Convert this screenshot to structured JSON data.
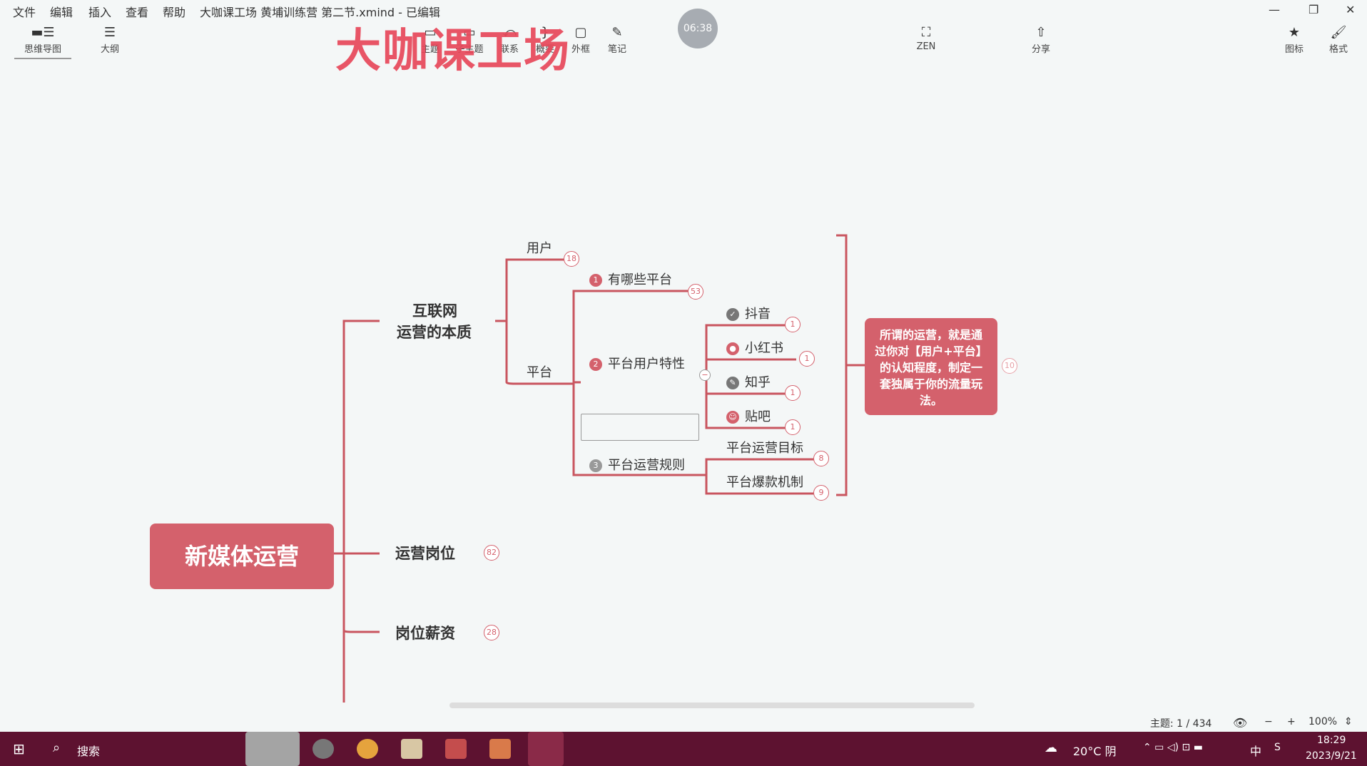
{
  "menu": {
    "file": "文件",
    "edit": "编辑",
    "insert": "插入",
    "view": "查看",
    "help": "帮助",
    "title": "大咖课工场 黄埔训练营 第二节.xmind - 已编辑"
  },
  "toolbar": {
    "mindmap": "思维导图",
    "outline": "大纲",
    "topic": "主题",
    "subtopic": "子主题",
    "relation": "联系",
    "summary": "概要",
    "boundary": "外框",
    "note": "笔记",
    "zen": "ZEN",
    "share": "分享",
    "icon": "图标",
    "format": "格式"
  },
  "watermark": "大咖课工场",
  "timer": "06:38",
  "map": {
    "root": "新媒体运营",
    "branch1": "互联网",
    "branch1b": "运营的本质",
    "branch2": "运营岗位",
    "branch2_count": "82",
    "branch3": "岗位薪资",
    "branch3_count": "28",
    "user": "用户",
    "user_count": "18",
    "platform": "平台",
    "which": "有哪些平台",
    "which_num": "1",
    "which_count": "53",
    "traits": "平台用户特性",
    "traits_num": "2",
    "rules": "平台运营规则",
    "rules_num": "3",
    "douyin": "抖音",
    "xhs": "小红书",
    "zhihu": "知乎",
    "tieba": "贴吧",
    "leaf_count": "1",
    "goal": "平台运营目标",
    "goal_count": "8",
    "viral": "平台爆款机制",
    "viral_count": "9",
    "callout": "所谓的运营，就是通过你对【用户+平台】的认知程度，制定一套独属于你的流量玩法。",
    "callout_count": "10"
  },
  "status": {
    "topics": "主题: 1 / 434",
    "zoom": "100%"
  },
  "taskbar": {
    "search": "搜索",
    "weather": "20°C 阴",
    "ime": "中",
    "time": "18:29",
    "date": "2023/9/21"
  },
  "colors": {
    "accent": "#d4616c",
    "taskbar": "#5d1230"
  }
}
